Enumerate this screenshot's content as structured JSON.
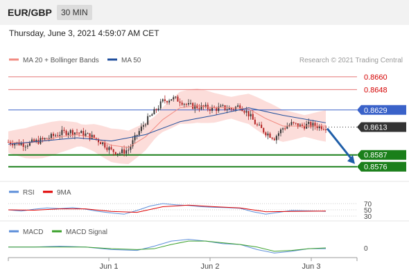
{
  "header": {
    "pair": "EUR/GBP",
    "timeframe": "30 MIN",
    "datetime": "Thursday, June 3, 2021 4:59:07 AM CET"
  },
  "colors": {
    "ma20": "#f28b82",
    "ma50": "#1f4e9c",
    "resistance": "#e57373",
    "pivot": "#3a62c9",
    "support": "#1a7f1a",
    "current": "#333333",
    "rsi": "#5b8dd9",
    "rsi_ma": "#e00000",
    "macd": "#5b8dd9",
    "macd_signal": "#3aa02a",
    "arrow": "#1f5ea8"
  },
  "chart_data": [
    {
      "type": "candlestick",
      "legend": [
        {
          "name": "MA 20 + Bollinger Bands",
          "color": "#f28b82"
        },
        {
          "name": "MA 50",
          "color": "#1f4e9c"
        }
      ],
      "credit": "Research © 2021 Trading Central",
      "ylim": [
        0.857,
        0.8667
      ],
      "x_ticks": [
        "Jun 1",
        "Jun 2",
        "Jun 3"
      ],
      "levels": [
        {
          "label": "0.8660",
          "value": 0.866,
          "kind": "resistance"
        },
        {
          "label": "0.8648",
          "value": 0.8648,
          "kind": "resistance"
        },
        {
          "label": "0.8629",
          "value": 0.8629,
          "kind": "pivot"
        },
        {
          "label": "0.8613",
          "value": 0.8613,
          "kind": "current"
        },
        {
          "label": "0.8587",
          "value": 0.8587,
          "kind": "support"
        },
        {
          "label": "0.8576",
          "value": 0.8576,
          "kind": "support"
        }
      ],
      "close_path": [
        [
          0,
          0.8599
        ],
        [
          4,
          0.8598
        ],
        [
          8,
          0.8597
        ],
        [
          12,
          0.8599
        ],
        [
          16,
          0.8601
        ],
        [
          20,
          0.8604
        ],
        [
          24,
          0.8607
        ],
        [
          28,
          0.8609
        ],
        [
          32,
          0.8608
        ],
        [
          36,
          0.8606
        ],
        [
          40,
          0.8603
        ],
        [
          44,
          0.8598
        ],
        [
          48,
          0.8591
        ],
        [
          52,
          0.8589
        ],
        [
          56,
          0.8592
        ],
        [
          60,
          0.8606
        ],
        [
          64,
          0.8618
        ],
        [
          68,
          0.8627
        ],
        [
          72,
          0.8637
        ],
        [
          76,
          0.864
        ],
        [
          80,
          0.8638
        ],
        [
          84,
          0.8633
        ],
        [
          88,
          0.8632
        ],
        [
          92,
          0.8631
        ],
        [
          96,
          0.863
        ],
        [
          100,
          0.8631
        ],
        [
          104,
          0.863
        ],
        [
          108,
          0.8633
        ],
        [
          112,
          0.8625
        ],
        [
          116,
          0.8614
        ],
        [
          120,
          0.8608
        ],
        [
          124,
          0.8603
        ],
        [
          128,
          0.8612
        ],
        [
          132,
          0.8616
        ],
        [
          136,
          0.8614
        ],
        [
          140,
          0.8615
        ],
        [
          144,
          0.8614
        ],
        [
          148,
          0.8613
        ]
      ],
      "ma20": [
        [
          0,
          0.8599
        ],
        [
          8,
          0.8598
        ],
        [
          16,
          0.86
        ],
        [
          24,
          0.8604
        ],
        [
          32,
          0.8606
        ],
        [
          40,
          0.8603
        ],
        [
          48,
          0.8596
        ],
        [
          56,
          0.8594
        ],
        [
          64,
          0.8604
        ],
        [
          72,
          0.862
        ],
        [
          80,
          0.8631
        ],
        [
          88,
          0.8633
        ],
        [
          96,
          0.8631
        ],
        [
          104,
          0.8631
        ],
        [
          112,
          0.863
        ],
        [
          120,
          0.8621
        ],
        [
          128,
          0.8614
        ],
        [
          136,
          0.8614
        ],
        [
          148,
          0.8614
        ]
      ],
      "ma50": [
        [
          0,
          0.8597
        ],
        [
          16,
          0.86
        ],
        [
          32,
          0.8603
        ],
        [
          48,
          0.86
        ],
        [
          64,
          0.8606
        ],
        [
          80,
          0.8618
        ],
        [
          96,
          0.8624
        ],
        [
          112,
          0.8631
        ],
        [
          128,
          0.8624
        ],
        [
          148,
          0.8617
        ]
      ],
      "forecast": {
        "from": 0.8613,
        "to": 0.8576
      }
    },
    {
      "type": "line",
      "legend": [
        {
          "name": "RSI",
          "color": "#5b8dd9"
        },
        {
          "name": "9MA",
          "color": "#e00000"
        }
      ],
      "y_ticks": [
        {
          "label": "70",
          "value": 70
        },
        {
          "label": "50",
          "value": 50
        },
        {
          "label": "30",
          "value": 30
        }
      ],
      "ylim": [
        25,
        75
      ],
      "rsi": [
        [
          0,
          50
        ],
        [
          6,
          46
        ],
        [
          12,
          52
        ],
        [
          18,
          56
        ],
        [
          24,
          54
        ],
        [
          30,
          57
        ],
        [
          36,
          52
        ],
        [
          42,
          45
        ],
        [
          48,
          40
        ],
        [
          54,
          36
        ],
        [
          60,
          48
        ],
        [
          66,
          62
        ],
        [
          72,
          70
        ],
        [
          78,
          66
        ],
        [
          84,
          64
        ],
        [
          90,
          60
        ],
        [
          96,
          58
        ],
        [
          102,
          57
        ],
        [
          108,
          55
        ],
        [
          114,
          44
        ],
        [
          120,
          36
        ],
        [
          126,
          42
        ],
        [
          132,
          48
        ],
        [
          138,
          47
        ],
        [
          144,
          46
        ],
        [
          148,
          45
        ]
      ],
      "rsi_ma": [
        [
          0,
          50
        ],
        [
          12,
          49
        ],
        [
          24,
          53
        ],
        [
          36,
          53
        ],
        [
          48,
          45
        ],
        [
          60,
          42
        ],
        [
          72,
          60
        ],
        [
          84,
          65
        ],
        [
          96,
          60
        ],
        [
          108,
          56
        ],
        [
          120,
          44
        ],
        [
          132,
          45
        ],
        [
          148,
          46
        ]
      ]
    },
    {
      "type": "line",
      "legend": [
        {
          "name": "MACD",
          "color": "#5b8dd9"
        },
        {
          "name": "MACD Signal",
          "color": "#3aa02a"
        }
      ],
      "y_ticks": [
        {
          "label": "0",
          "value": 0
        }
      ],
      "ylim": [
        -0.0009,
        0.0013
      ],
      "macd": [
        [
          0,
          0.0001
        ],
        [
          12,
          0.0001
        ],
        [
          24,
          0.0002
        ],
        [
          36,
          0.0001
        ],
        [
          48,
          -0.0002
        ],
        [
          60,
          -0.0003
        ],
        [
          68,
          0.0002
        ],
        [
          76,
          0.0008
        ],
        [
          84,
          0.001
        ],
        [
          92,
          0.0008
        ],
        [
          100,
          0.0005
        ],
        [
          108,
          0.0004
        ],
        [
          116,
          -0.0002
        ],
        [
          124,
          -0.0006
        ],
        [
          132,
          -0.0004
        ],
        [
          140,
          -0.0001
        ],
        [
          148,
          -0.0001
        ]
      ],
      "macd_signal": [
        [
          0,
          0.0001
        ],
        [
          12,
          0.0001
        ],
        [
          24,
          0.0001
        ],
        [
          36,
          0.0001
        ],
        [
          48,
          -0.0001
        ],
        [
          60,
          -0.0002
        ],
        [
          68,
          -0.0001
        ],
        [
          76,
          0.0004
        ],
        [
          84,
          0.0008
        ],
        [
          92,
          0.0008
        ],
        [
          100,
          0.0006
        ],
        [
          108,
          0.0004
        ],
        [
          116,
          0.0001
        ],
        [
          124,
          -0.0004
        ],
        [
          132,
          -0.0003
        ],
        [
          140,
          -0.0001
        ],
        [
          148,
          0
        ]
      ]
    }
  ]
}
